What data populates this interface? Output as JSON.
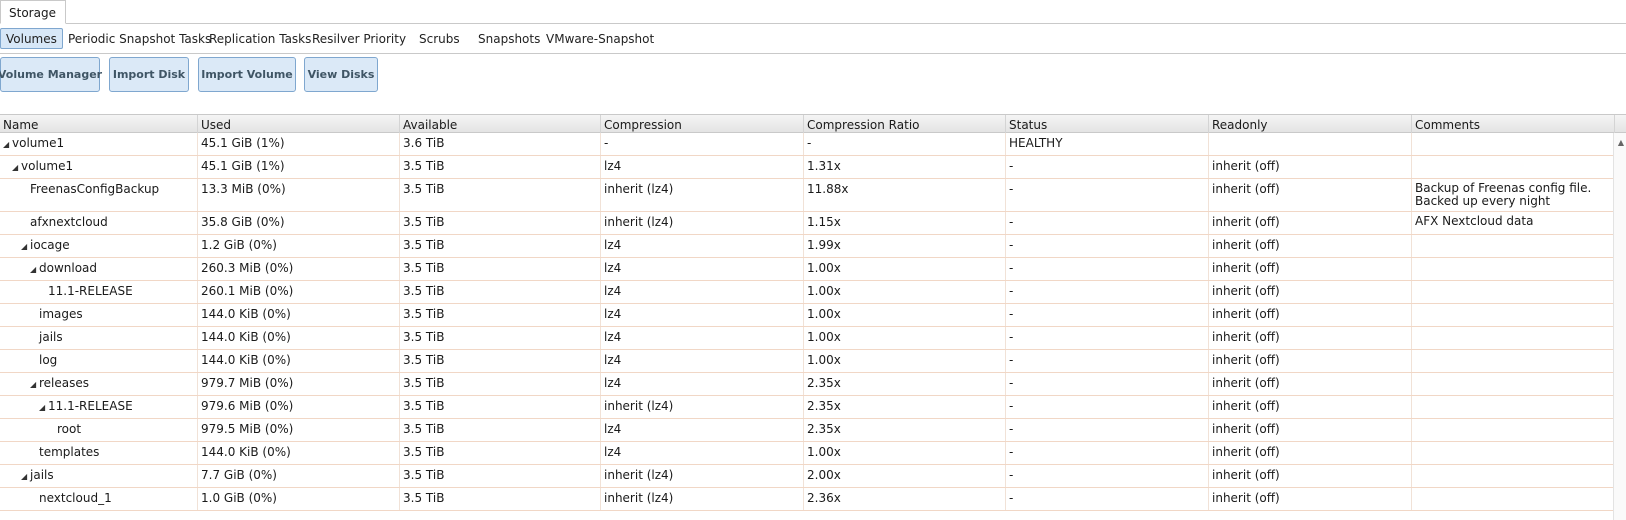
{
  "tabs": {
    "storage": "Storage"
  },
  "subtabs": [
    "Volumes",
    "Periodic Snapshot Tasks",
    "Replication Tasks",
    "Resilver Priority",
    "Scrubs",
    "Snapshots",
    "VMware-Snapshot"
  ],
  "buttons": [
    "Volume Manager",
    "Import Disk",
    "Import Volume",
    "View Disks"
  ],
  "columns": [
    "Name",
    "Used",
    "Available",
    "Compression",
    "Compression Ratio",
    "Status",
    "Readonly",
    "Comments"
  ],
  "expand_glyph": "◢",
  "rows": [
    {
      "name": "volume1",
      "used": "45.1 GiB (1%)",
      "available": "3.6 TiB",
      "compression": "-",
      "ratio": "-",
      "status": "HEALTHY",
      "readonly": "",
      "comments": ""
    },
    {
      "name": "volume1",
      "used": "45.1 GiB (1%)",
      "available": "3.5 TiB",
      "compression": "lz4",
      "ratio": "1.31x",
      "status": "-",
      "readonly": "inherit (off)",
      "comments": ""
    },
    {
      "name": "FreenasConfigBackup",
      "used": "13.3 MiB (0%)",
      "available": "3.5 TiB",
      "compression": "inherit (lz4)",
      "ratio": "11.88x",
      "status": "-",
      "readonly": "inherit (off)",
      "comments": "Backup of Freenas config file. Backed up every night"
    },
    {
      "name": "afxnextcloud",
      "used": "35.8 GiB (0%)",
      "available": "3.5 TiB",
      "compression": "inherit (lz4)",
      "ratio": "1.15x",
      "status": "-",
      "readonly": "inherit (off)",
      "comments": "AFX Nextcloud data"
    },
    {
      "name": "iocage",
      "used": "1.2 GiB (0%)",
      "available": "3.5 TiB",
      "compression": "lz4",
      "ratio": "1.99x",
      "status": "-",
      "readonly": "inherit (off)",
      "comments": ""
    },
    {
      "name": "download",
      "used": "260.3 MiB (0%)",
      "available": "3.5 TiB",
      "compression": "lz4",
      "ratio": "1.00x",
      "status": "-",
      "readonly": "inherit (off)",
      "comments": ""
    },
    {
      "name": "11.1-RELEASE",
      "used": "260.1 MiB (0%)",
      "available": "3.5 TiB",
      "compression": "lz4",
      "ratio": "1.00x",
      "status": "-",
      "readonly": "inherit (off)",
      "comments": ""
    },
    {
      "name": "images",
      "used": "144.0 KiB (0%)",
      "available": "3.5 TiB",
      "compression": "lz4",
      "ratio": "1.00x",
      "status": "-",
      "readonly": "inherit (off)",
      "comments": ""
    },
    {
      "name": "jails",
      "used": "144.0 KiB (0%)",
      "available": "3.5 TiB",
      "compression": "lz4",
      "ratio": "1.00x",
      "status": "-",
      "readonly": "inherit (off)",
      "comments": ""
    },
    {
      "name": "log",
      "used": "144.0 KiB (0%)",
      "available": "3.5 TiB",
      "compression": "lz4",
      "ratio": "1.00x",
      "status": "-",
      "readonly": "inherit (off)",
      "comments": ""
    },
    {
      "name": "releases",
      "used": "979.7 MiB (0%)",
      "available": "3.5 TiB",
      "compression": "lz4",
      "ratio": "2.35x",
      "status": "-",
      "readonly": "inherit (off)",
      "comments": ""
    },
    {
      "name": "11.1-RELEASE",
      "used": "979.6 MiB (0%)",
      "available": "3.5 TiB",
      "compression": "inherit (lz4)",
      "ratio": "2.35x",
      "status": "-",
      "readonly": "inherit (off)",
      "comments": ""
    },
    {
      "name": "root",
      "used": "979.5 MiB (0%)",
      "available": "3.5 TiB",
      "compression": "lz4",
      "ratio": "2.35x",
      "status": "-",
      "readonly": "inherit (off)",
      "comments": ""
    },
    {
      "name": "templates",
      "used": "144.0 KiB (0%)",
      "available": "3.5 TiB",
      "compression": "lz4",
      "ratio": "1.00x",
      "status": "-",
      "readonly": "inherit (off)",
      "comments": ""
    },
    {
      "name": "jails",
      "used": "7.7 GiB (0%)",
      "available": "3.5 TiB",
      "compression": "inherit (lz4)",
      "ratio": "2.00x",
      "status": "-",
      "readonly": "inherit (off)",
      "comments": ""
    },
    {
      "name": "nextcloud_1",
      "used": "1.0 GiB (0%)",
      "available": "3.5 TiB",
      "compression": "inherit (lz4)",
      "ratio": "2.36x",
      "status": "-",
      "readonly": "inherit (off)",
      "comments": ""
    }
  ]
}
